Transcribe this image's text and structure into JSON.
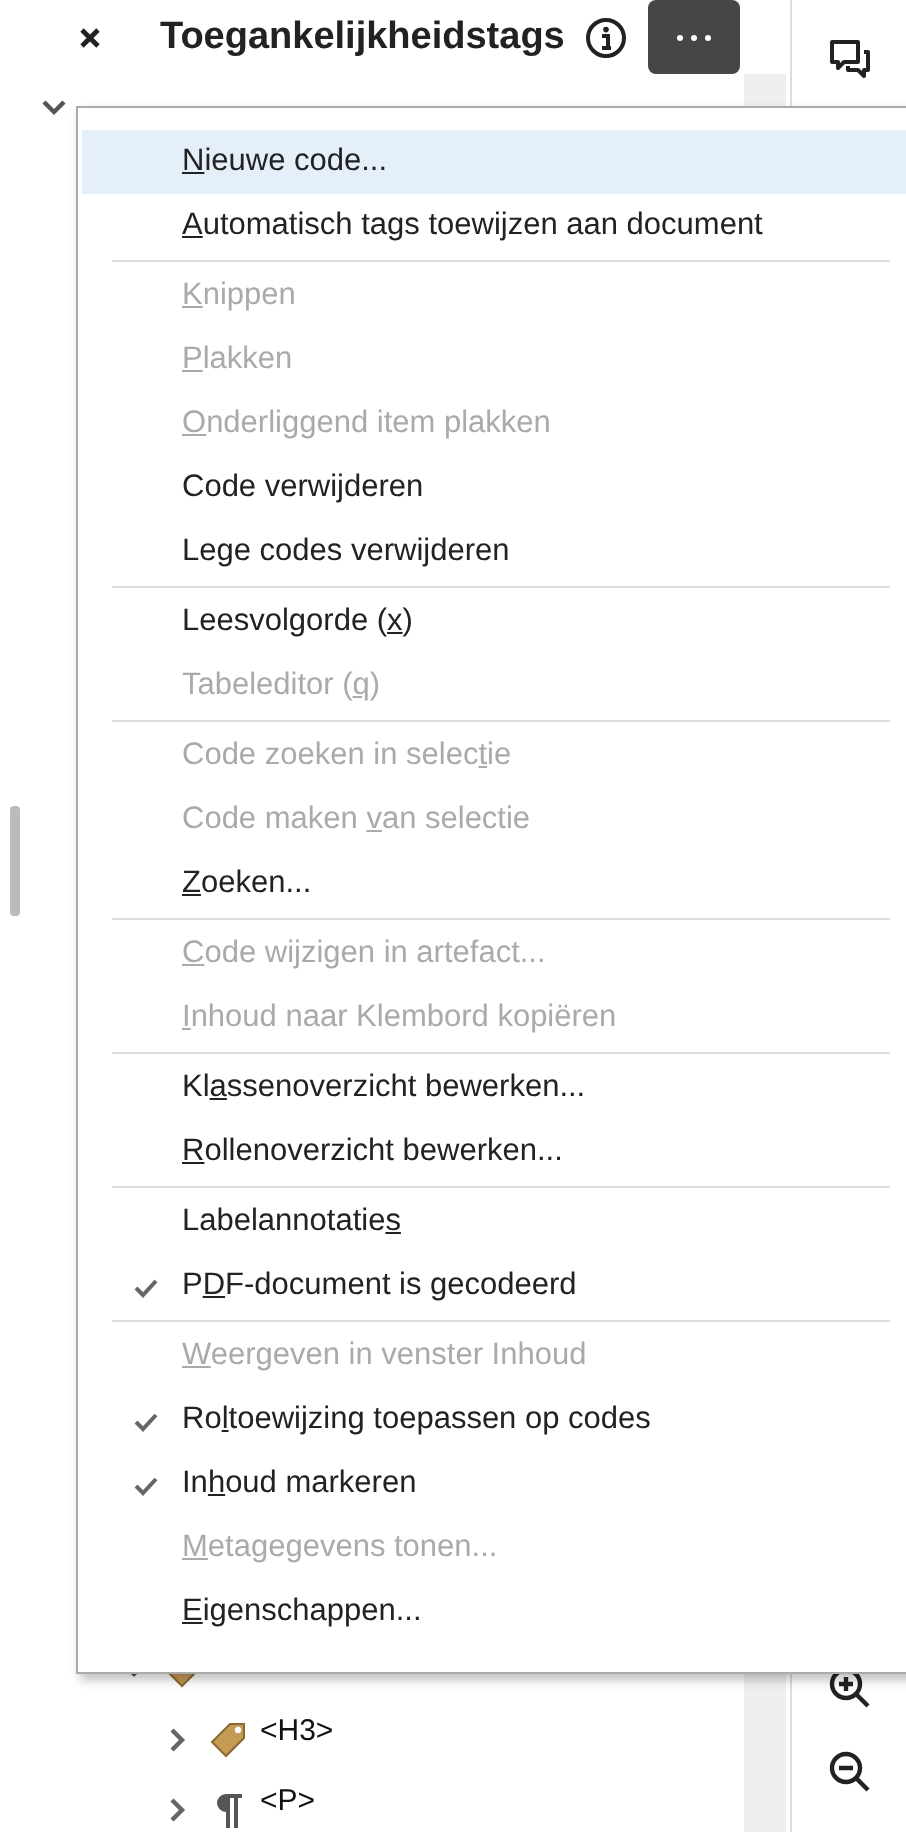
{
  "panel": {
    "title": "Toegankelijkheidstags"
  },
  "menu": {
    "groups": [
      [
        {
          "key": "N",
          "post": "ieuwe code...",
          "disabled": false,
          "checked": false,
          "highlighted": true
        },
        {
          "key": "A",
          "post": "utomatisch tags toewijzen aan document",
          "disabled": false,
          "checked": false,
          "highlighted": false
        }
      ],
      [
        {
          "key": "K",
          "post": "nippen",
          "disabled": true,
          "checked": false,
          "highlighted": false
        },
        {
          "key": "P",
          "post": "lakken",
          "disabled": true,
          "checked": false,
          "highlighted": false
        },
        {
          "key": "O",
          "post": "nderliggend item plakken",
          "disabled": true,
          "checked": false,
          "highlighted": false
        },
        {
          "pre": "Code verwijderen",
          "disabled": false,
          "checked": false,
          "highlighted": false
        },
        {
          "pre": "Le",
          "key": "g",
          "post": "e codes verwijderen",
          "disabled": false,
          "checked": false,
          "highlighted": false
        }
      ],
      [
        {
          "pre": "Leesvolgorde (",
          "key": "x",
          "post": ")",
          "disabled": false,
          "checked": false,
          "highlighted": false
        },
        {
          "pre": "Tabeleditor (",
          "key": "q",
          "post": ")",
          "disabled": true,
          "checked": false,
          "highlighted": false
        }
      ],
      [
        {
          "pre": "Code zoeken in selec",
          "key": "t",
          "post": "ie",
          "disabled": true,
          "checked": false,
          "highlighted": false
        },
        {
          "pre": "Code maken ",
          "key": "v",
          "post": "an selectie",
          "disabled": true,
          "checked": false,
          "highlighted": false
        },
        {
          "key": "Z",
          "post": "oeken...",
          "disabled": false,
          "checked": false,
          "highlighted": false
        }
      ],
      [
        {
          "key": "C",
          "post": "ode wijzigen in artefact...",
          "disabled": true,
          "checked": false,
          "highlighted": false
        },
        {
          "key": "I",
          "post": "nhoud naar Klembord kopiëren",
          "disabled": true,
          "checked": false,
          "highlighted": false
        }
      ],
      [
        {
          "pre": "Kl",
          "key": "a",
          "post": "ssenoverzicht bewerken...",
          "disabled": false,
          "checked": false,
          "highlighted": false
        },
        {
          "key": "R",
          "post": "ollenoverzicht bewerken...",
          "disabled": false,
          "checked": false,
          "highlighted": false
        }
      ],
      [
        {
          "pre": "Labelannotatie",
          "key": "s",
          "disabled": false,
          "checked": false,
          "highlighted": false
        },
        {
          "pre": "P",
          "key": "D",
          "post": "F-document is gecodeerd",
          "disabled": false,
          "checked": true,
          "highlighted": false
        }
      ],
      [
        {
          "key": "W",
          "post": "eergeven in venster Inhoud",
          "disabled": true,
          "checked": false,
          "highlighted": false
        },
        {
          "pre": "Ro",
          "key": "l",
          "post": "toewijzing toepassen op codes",
          "disabled": false,
          "checked": true,
          "highlighted": false
        },
        {
          "pre": "In",
          "key": "h",
          "post": "oud markeren",
          "disabled": false,
          "checked": true,
          "highlighted": false
        },
        {
          "key": "M",
          "post": "etagegevens tonen...",
          "disabled": true,
          "checked": false,
          "highlighted": false
        },
        {
          "key": "E",
          "post": "igenschappen...",
          "disabled": false,
          "checked": false,
          "highlighted": false
        }
      ]
    ]
  },
  "tree": {
    "expanded": true,
    "children": [
      {
        "kind": "tag",
        "expanded": true,
        "children": [
          {
            "label": "<H3>",
            "kind": "tag",
            "expanded": false
          },
          {
            "label": "<P>",
            "kind": "paragraph",
            "expanded": false
          }
        ]
      }
    ]
  }
}
